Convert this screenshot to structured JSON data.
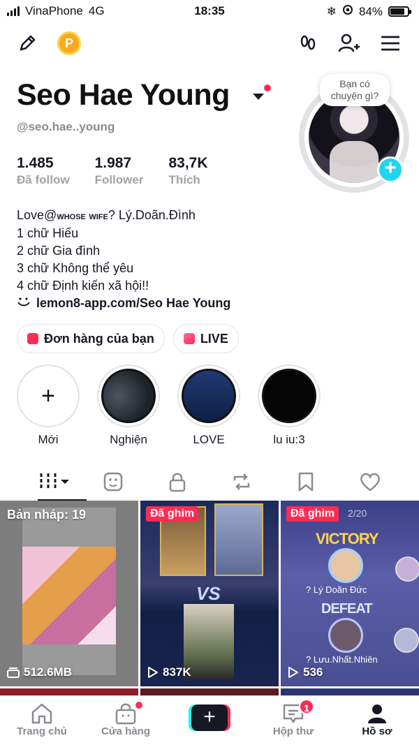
{
  "status_bar": {
    "carrier": "VinaPhone",
    "network": "4G",
    "time": "18:35",
    "battery": "84%",
    "battery_level": 0.84
  },
  "profile": {
    "name": "Seo Hae Young",
    "handle": "@seo.hae..young",
    "avatar_bubble": "Bạn có chuyện gì?",
    "stats": [
      {
        "value": "1.485",
        "label": "Đã follow"
      },
      {
        "value": "1.987",
        "label": "Follower"
      },
      {
        "value": "83,7K",
        "label": "Thích"
      }
    ],
    "bio": {
      "line1_a": "Love@",
      "line1_b": "whose wife",
      "line1_c": "? Lý.Doãn.Đình",
      "line2": "1 chữ Hiếu",
      "line3": "2 chữ Gia đình",
      "line4": "3 chữ Không thể yêu",
      "line5": "4 chữ Định kiến xã hội!!",
      "link": "lemon8-app.com/Seo Hae Young"
    }
  },
  "chips": {
    "orders": "Đơn hàng của bạn",
    "live": "LIVE"
  },
  "highlights": [
    {
      "label": "Mới"
    },
    {
      "label": "Nghiện"
    },
    {
      "label": "LOVE"
    },
    {
      "label": "lu iu:3"
    }
  ],
  "grid": [
    {
      "tag": "Bản nháp: 19",
      "count": "512.6MB"
    },
    {
      "tag": "Đã ghim",
      "count": "837K"
    },
    {
      "tag": "Đã ghim",
      "count": "536",
      "overlay_page": "2/20",
      "victory": "VICTORY",
      "defeat": "DEFEAT",
      "player1": "? Lý Doãn Đức",
      "player2": "? Lưu.Nhất.Nhiên"
    }
  ],
  "bottom_nav": {
    "home": "Trang chủ",
    "shop": "Cửa hàng",
    "inbox": "Hộp thư",
    "inbox_badge": "1",
    "profile": "Hồ sơ"
  },
  "colors": {
    "accent": "#fe2c55",
    "cyan": "#25f4ee",
    "text": "#161823",
    "muted": "#8a8b91"
  }
}
